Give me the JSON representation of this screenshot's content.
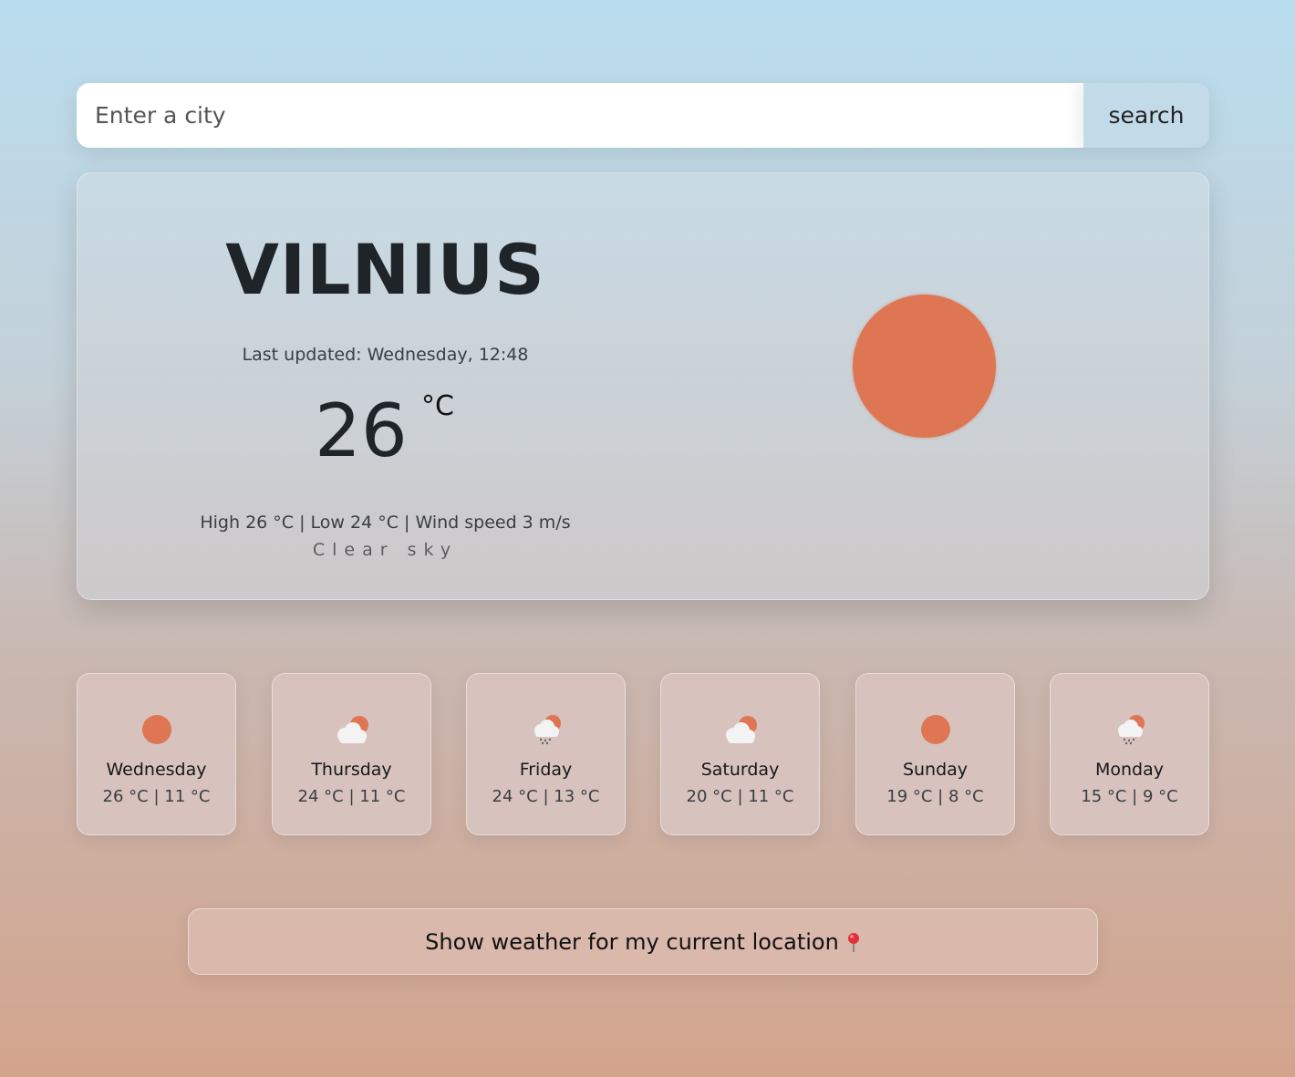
{
  "search": {
    "placeholder": "Enter a city",
    "button_label": "search"
  },
  "current": {
    "city": "VILNIUS",
    "last_updated": "Last updated: Wednesday, 12:48",
    "temperature": "26",
    "unit": "°C",
    "details": "High 26 °C | Low 24 °C | Wind speed 3 m/s",
    "description": "Clear sky",
    "icon": "sun-icon",
    "accent_color": "#de7654"
  },
  "forecast": [
    {
      "day": "Wednesday",
      "temps": "26 °C | 11 °C",
      "icon": "sun-icon"
    },
    {
      "day": "Thursday",
      "temps": "24 °C | 11 °C",
      "icon": "cloud-sun-icon"
    },
    {
      "day": "Friday",
      "temps": "24 °C | 13 °C",
      "icon": "rain-cloud-sun-icon"
    },
    {
      "day": "Saturday",
      "temps": "20 °C | 11 °C",
      "icon": "cloud-sun-icon"
    },
    {
      "day": "Sunday",
      "temps": "19 °C | 8 °C",
      "icon": "sun-icon"
    },
    {
      "day": "Monday",
      "temps": "15 °C | 9 °C",
      "icon": "rain-cloud-sun-icon"
    }
  ],
  "location_button": {
    "label": "Show weather for my current location",
    "icon": "pin-icon"
  }
}
